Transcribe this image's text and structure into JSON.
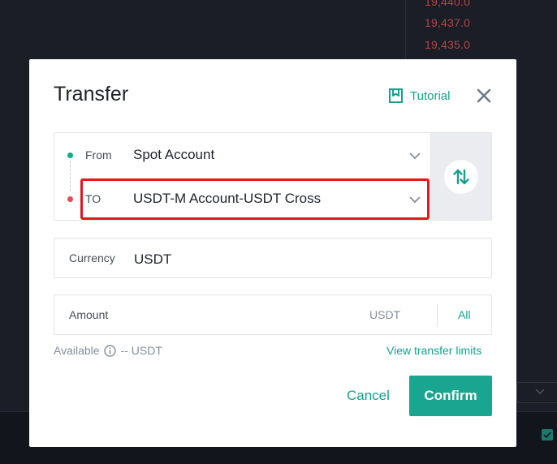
{
  "background": {
    "prices": [
      "19,440.0",
      "19,437.0",
      "19,435.0"
    ],
    "colors": {
      "price_red": "#b24545",
      "bg": "#1b1e27"
    }
  },
  "dialog": {
    "title": "Transfer",
    "tutorial_label": "Tutorial",
    "icons": {
      "tutorial": "bookmark-icon",
      "close": "close-icon",
      "swap": "swap-arrows-icon",
      "info": "info-icon",
      "dropdown": "chevron-down-icon"
    },
    "from": {
      "label": "From",
      "value": "Spot Account"
    },
    "to": {
      "label": "TO",
      "value": "USDT-M Account-USDT Cross"
    },
    "currency": {
      "label": "Currency",
      "value": "USDT"
    },
    "amount": {
      "label": "Amount",
      "placeholder": "",
      "unit": "USDT",
      "all_label": "All"
    },
    "available": {
      "label": "Available",
      "value": "-- USDT"
    },
    "limits_link": "View transfer limits",
    "cancel_label": "Cancel",
    "confirm_label": "Confirm",
    "colors": {
      "accent": "#15a18d",
      "confirm_bg": "#1aa591",
      "from_dot": "#0fab87",
      "to_dot": "#ea4a4a",
      "highlight": "#e11919"
    }
  }
}
